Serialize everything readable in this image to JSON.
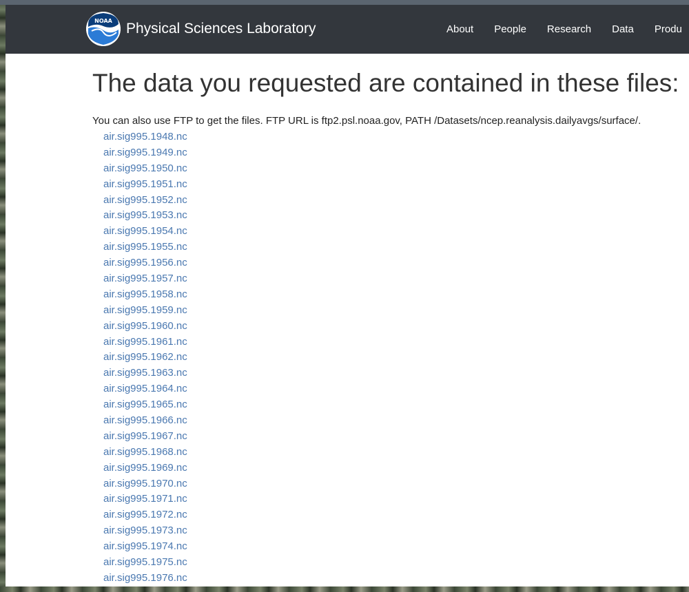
{
  "header": {
    "brand_name": "Physical Sciences Laboratory",
    "logo_text": "NOAA",
    "nav_items": [
      "About",
      "People",
      "Research",
      "Data",
      "Produ"
    ]
  },
  "main": {
    "title": "The data you requested are contained in these files:",
    "intro": "You can also use FTP to get the files. FTP URL is ftp2.psl.noaa.gov, PATH /Datasets/ncep.reanalysis.dailyavgs/surface/.",
    "files": [
      "air.sig995.1948.nc",
      "air.sig995.1949.nc",
      "air.sig995.1950.nc",
      "air.sig995.1951.nc",
      "air.sig995.1952.nc",
      "air.sig995.1953.nc",
      "air.sig995.1954.nc",
      "air.sig995.1955.nc",
      "air.sig995.1956.nc",
      "air.sig995.1957.nc",
      "air.sig995.1958.nc",
      "air.sig995.1959.nc",
      "air.sig995.1960.nc",
      "air.sig995.1961.nc",
      "air.sig995.1962.nc",
      "air.sig995.1963.nc",
      "air.sig995.1964.nc",
      "air.sig995.1965.nc",
      "air.sig995.1966.nc",
      "air.sig995.1967.nc",
      "air.sig995.1968.nc",
      "air.sig995.1969.nc",
      "air.sig995.1970.nc",
      "air.sig995.1971.nc",
      "air.sig995.1972.nc",
      "air.sig995.1973.nc",
      "air.sig995.1974.nc",
      "air.sig995.1975.nc",
      "air.sig995.1976.nc"
    ]
  },
  "colors": {
    "navbar": "#33373d",
    "link": "#4a78b0",
    "title": "#333333",
    "logo_blue": "#2b7bd6"
  },
  "icons": {
    "logo": "noaa-logo-icon"
  }
}
